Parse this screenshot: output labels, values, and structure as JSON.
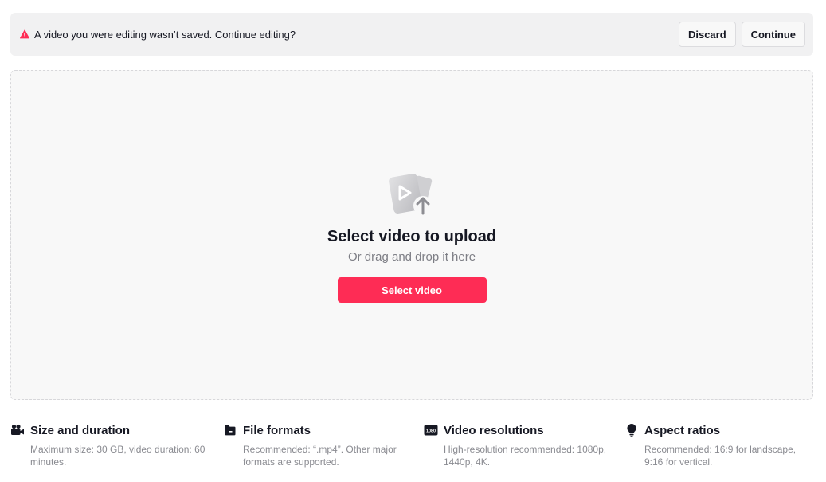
{
  "banner": {
    "message": "A video you were editing wasn’t saved. Continue editing?",
    "discard_label": "Discard",
    "continue_label": "Continue",
    "warning_color": "#fe2c55"
  },
  "dropzone": {
    "title": "Select video to upload",
    "subtitle": "Or drag and drop it here",
    "button_label": "Select video",
    "accent": "#fe2c55"
  },
  "info": [
    {
      "icon": "video-camera-icon",
      "title": "Size and duration",
      "desc": "Maximum size: 30 GB, video duration: 60 minutes."
    },
    {
      "icon": "folder-icon",
      "title": "File formats",
      "desc": "Recommended: “.mp4”. Other major formats are supported."
    },
    {
      "icon": "hd-resolution-icon",
      "title": "Video resolutions",
      "desc": "High-resolution recommended: 1080p, 1440p, 4K."
    },
    {
      "icon": "lightbulb-icon",
      "title": "Aspect ratios",
      "desc": "Recommended: 16:9 for landscape, 9:16 for vertical."
    }
  ],
  "resolution_icon_text": "1080"
}
